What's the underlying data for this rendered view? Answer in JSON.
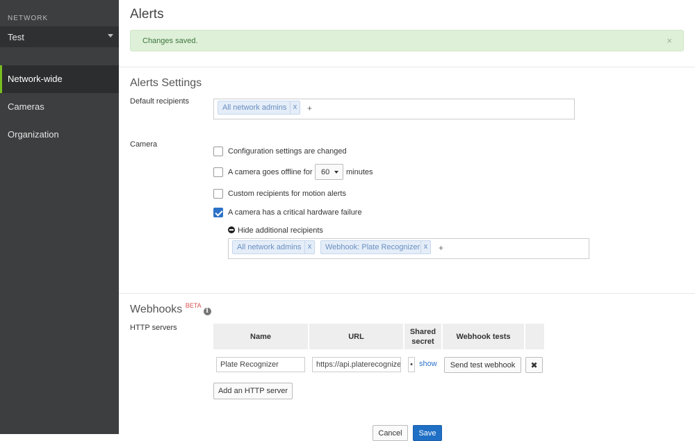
{
  "sidebar": {
    "network_label": "NETWORK",
    "network_value": "Test",
    "items": [
      {
        "label": "Network-wide",
        "active": true
      },
      {
        "label": "Cameras",
        "active": false
      },
      {
        "label": "Organization",
        "active": false
      }
    ]
  },
  "page_title": "Alerts",
  "banner": {
    "text": "Changes saved.",
    "close": "×"
  },
  "alerts_settings": {
    "title": "Alerts Settings",
    "default_recipients_label": "Default recipients",
    "default_recipients": [
      "All network admins"
    ],
    "tag_remove": "x",
    "tag_add": "+"
  },
  "camera": {
    "label": "Camera",
    "options": [
      {
        "label": "Configuration settings are changed",
        "checked": false
      },
      {
        "label_before": "A camera goes offline for",
        "select_value": "60",
        "label_after": "minutes",
        "checked": false
      },
      {
        "label": "Custom recipients for motion alerts",
        "checked": false
      },
      {
        "label": "A camera has a critical hardware failure",
        "checked": true
      }
    ],
    "hide_additional": "Hide additional recipients",
    "additional_recipients": [
      "All network admins",
      "Webhook: Plate Recognizer"
    ]
  },
  "webhooks": {
    "title": "Webhooks",
    "beta": "BETA",
    "info_icon": "i",
    "http_servers_label": "HTTP servers",
    "columns": [
      "Name",
      "URL",
      "Shared secret",
      "Webhook tests"
    ],
    "rows": [
      {
        "name": "Plate Recognizer",
        "url": "https://api.platerecognizer.com",
        "secret": "•",
        "show": "show",
        "test_button": "Send test webhook",
        "remove": "✖"
      }
    ],
    "add_button": "Add an HTTP server"
  },
  "footer": {
    "cancel": "Cancel",
    "save": "Save"
  }
}
